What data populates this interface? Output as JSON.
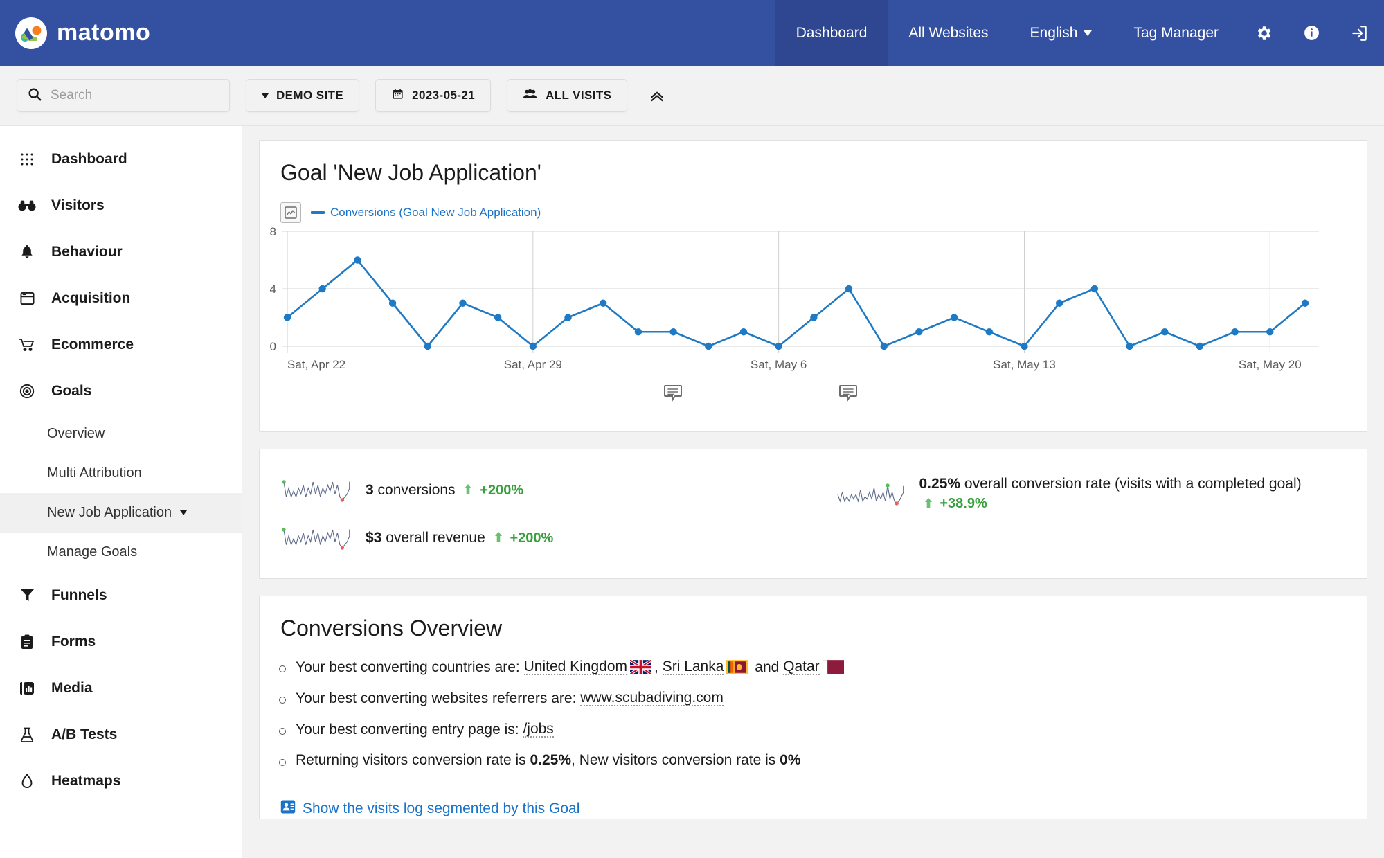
{
  "header": {
    "brand": "matomo",
    "nav": [
      {
        "label": "Dashboard",
        "active": true
      },
      {
        "label": "All Websites",
        "active": false
      },
      {
        "label": "English",
        "active": false,
        "has_caret": true
      },
      {
        "label": "Tag Manager",
        "active": false
      }
    ],
    "icons": [
      "gear-icon",
      "info-icon",
      "sign-in-icon"
    ],
    "colors": {
      "bar": "#3450a1",
      "active_tab": "#2e4790"
    }
  },
  "toolbar": {
    "search_placeholder": "Search",
    "site_selector": "DEMO SITE",
    "date_selector": "2023-05-21",
    "segment_selector": "ALL VISITS",
    "collapse_icon": "chevron-up-icon"
  },
  "sidebar": {
    "items": [
      {
        "label": "Dashboard",
        "icon": "grid-icon",
        "type": "main"
      },
      {
        "label": "Visitors",
        "icon": "binoculars-icon",
        "type": "main"
      },
      {
        "label": "Behaviour",
        "icon": "bell-icon",
        "type": "main"
      },
      {
        "label": "Acquisition",
        "icon": "window-icon",
        "type": "main"
      },
      {
        "label": "Ecommerce",
        "icon": "cart-icon",
        "type": "main"
      },
      {
        "label": "Goals",
        "icon": "target-icon",
        "type": "main"
      },
      {
        "label": "Overview",
        "type": "sub"
      },
      {
        "label": "Multi Attribution",
        "type": "sub"
      },
      {
        "label": "New Job Application",
        "type": "sub",
        "selected": true,
        "has_caret": true
      },
      {
        "label": "Manage Goals",
        "type": "sub"
      },
      {
        "label": "Funnels",
        "icon": "funnel-icon",
        "type": "main"
      },
      {
        "label": "Forms",
        "icon": "clipboard-icon",
        "type": "main"
      },
      {
        "label": "Media",
        "icon": "media-bars-icon",
        "type": "main"
      },
      {
        "label": "A/B Tests",
        "icon": "flask-icon",
        "type": "main"
      },
      {
        "label": "Heatmaps",
        "icon": "droplet-icon",
        "type": "main"
      }
    ]
  },
  "goal_card": {
    "title": "Goal 'New Job Application'",
    "legend_label": "Conversions (Goal New Job Application)"
  },
  "chart_data": {
    "type": "line",
    "title": "Goal 'New Job Application'",
    "series": [
      {
        "name": "Conversions (Goal New Job Application)",
        "color": "#1e7ac4",
        "values": [
          2,
          4,
          6,
          3,
          0,
          3,
          2,
          0,
          2,
          3,
          1,
          1,
          0,
          1,
          0,
          2,
          4,
          0,
          1,
          2,
          1,
          0,
          3,
          4,
          0,
          1,
          0,
          1,
          1,
          3
        ]
      }
    ],
    "x": [
      "Sat, Apr 22",
      "Sun, Apr 23",
      "Mon, Apr 24",
      "Tue, Apr 25",
      "Wed, Apr 26",
      "Thu, Apr 27",
      "Fri, Apr 28",
      "Sat, Apr 29",
      "Sun, Apr 30",
      "Mon, May 1",
      "Tue, May 2",
      "Wed, May 3",
      "Thu, May 4",
      "Fri, May 5",
      "Sat, May 6",
      "Sun, May 7",
      "Mon, May 8",
      "Tue, May 9",
      "Wed, May 10",
      "Thu, May 11",
      "Fri, May 12",
      "Sat, May 13",
      "Sun, May 14",
      "Mon, May 15",
      "Tue, May 16",
      "Wed, May 17",
      "Thu, May 18",
      "Fri, May 19",
      "Sat, May 20",
      "Sun, May 21"
    ],
    "xtick_labels": [
      "Sat, Apr 22",
      "Sat, Apr 29",
      "Sat, May 6",
      "Sat, May 13",
      "Sat, May 20"
    ],
    "xtick_indices": [
      0,
      7,
      14,
      21,
      28
    ],
    "ytick_labels": [
      "0",
      "4",
      "8"
    ],
    "yticks": [
      0,
      4,
      8
    ],
    "ylim": [
      0,
      8
    ],
    "xlabel": "",
    "ylabel": "",
    "grid": true,
    "legend_position": "top-left",
    "annotations": [
      {
        "x_index": 11,
        "icon": "annotation-icon"
      },
      {
        "x_index": 16,
        "icon": "annotation-icon"
      }
    ]
  },
  "sparklines": {
    "left": [
      {
        "value": "3",
        "label": "conversions",
        "evolution": "+200%",
        "direction": "up"
      },
      {
        "value": "$3",
        "label": "overall revenue",
        "evolution": "+200%",
        "direction": "up"
      }
    ],
    "right": [
      {
        "value": "0.25%",
        "label": "overall conversion rate (visits with a completed goal)",
        "evolution": "+38.9%",
        "direction": "up"
      }
    ],
    "evolution_color": "#37a03c"
  },
  "conversions_overview": {
    "title": "Conversions Overview",
    "items": [
      {
        "prefix": "Your best converting countries are:",
        "parts": [
          {
            "text": "United Kingdom",
            "link": true,
            "flag": "gb"
          },
          {
            "text": ",",
            "link": false
          },
          {
            "text": "Sri Lanka",
            "link": true,
            "flag": "lk"
          },
          {
            "text": "and",
            "link": false
          },
          {
            "text": "Qatar",
            "link": true,
            "flag": "qa"
          }
        ]
      },
      {
        "prefix": "Your best converting websites referrers are:",
        "parts": [
          {
            "text": "www.scubadiving.com",
            "link": true
          }
        ]
      },
      {
        "prefix": "Your best converting entry page is:",
        "parts": [
          {
            "text": "/jobs",
            "link": true
          }
        ]
      },
      {
        "prefix": "Returning visitors conversion rate is",
        "parts": [
          {
            "text": "0.25%",
            "bold": true
          },
          {
            "text": ", New visitors conversion rate is",
            "link": false
          },
          {
            "text": "0%",
            "bold": true
          }
        ]
      }
    ],
    "show_log_link": "Show the visits log segmented by this Goal",
    "link_color": "#1a73c8"
  }
}
